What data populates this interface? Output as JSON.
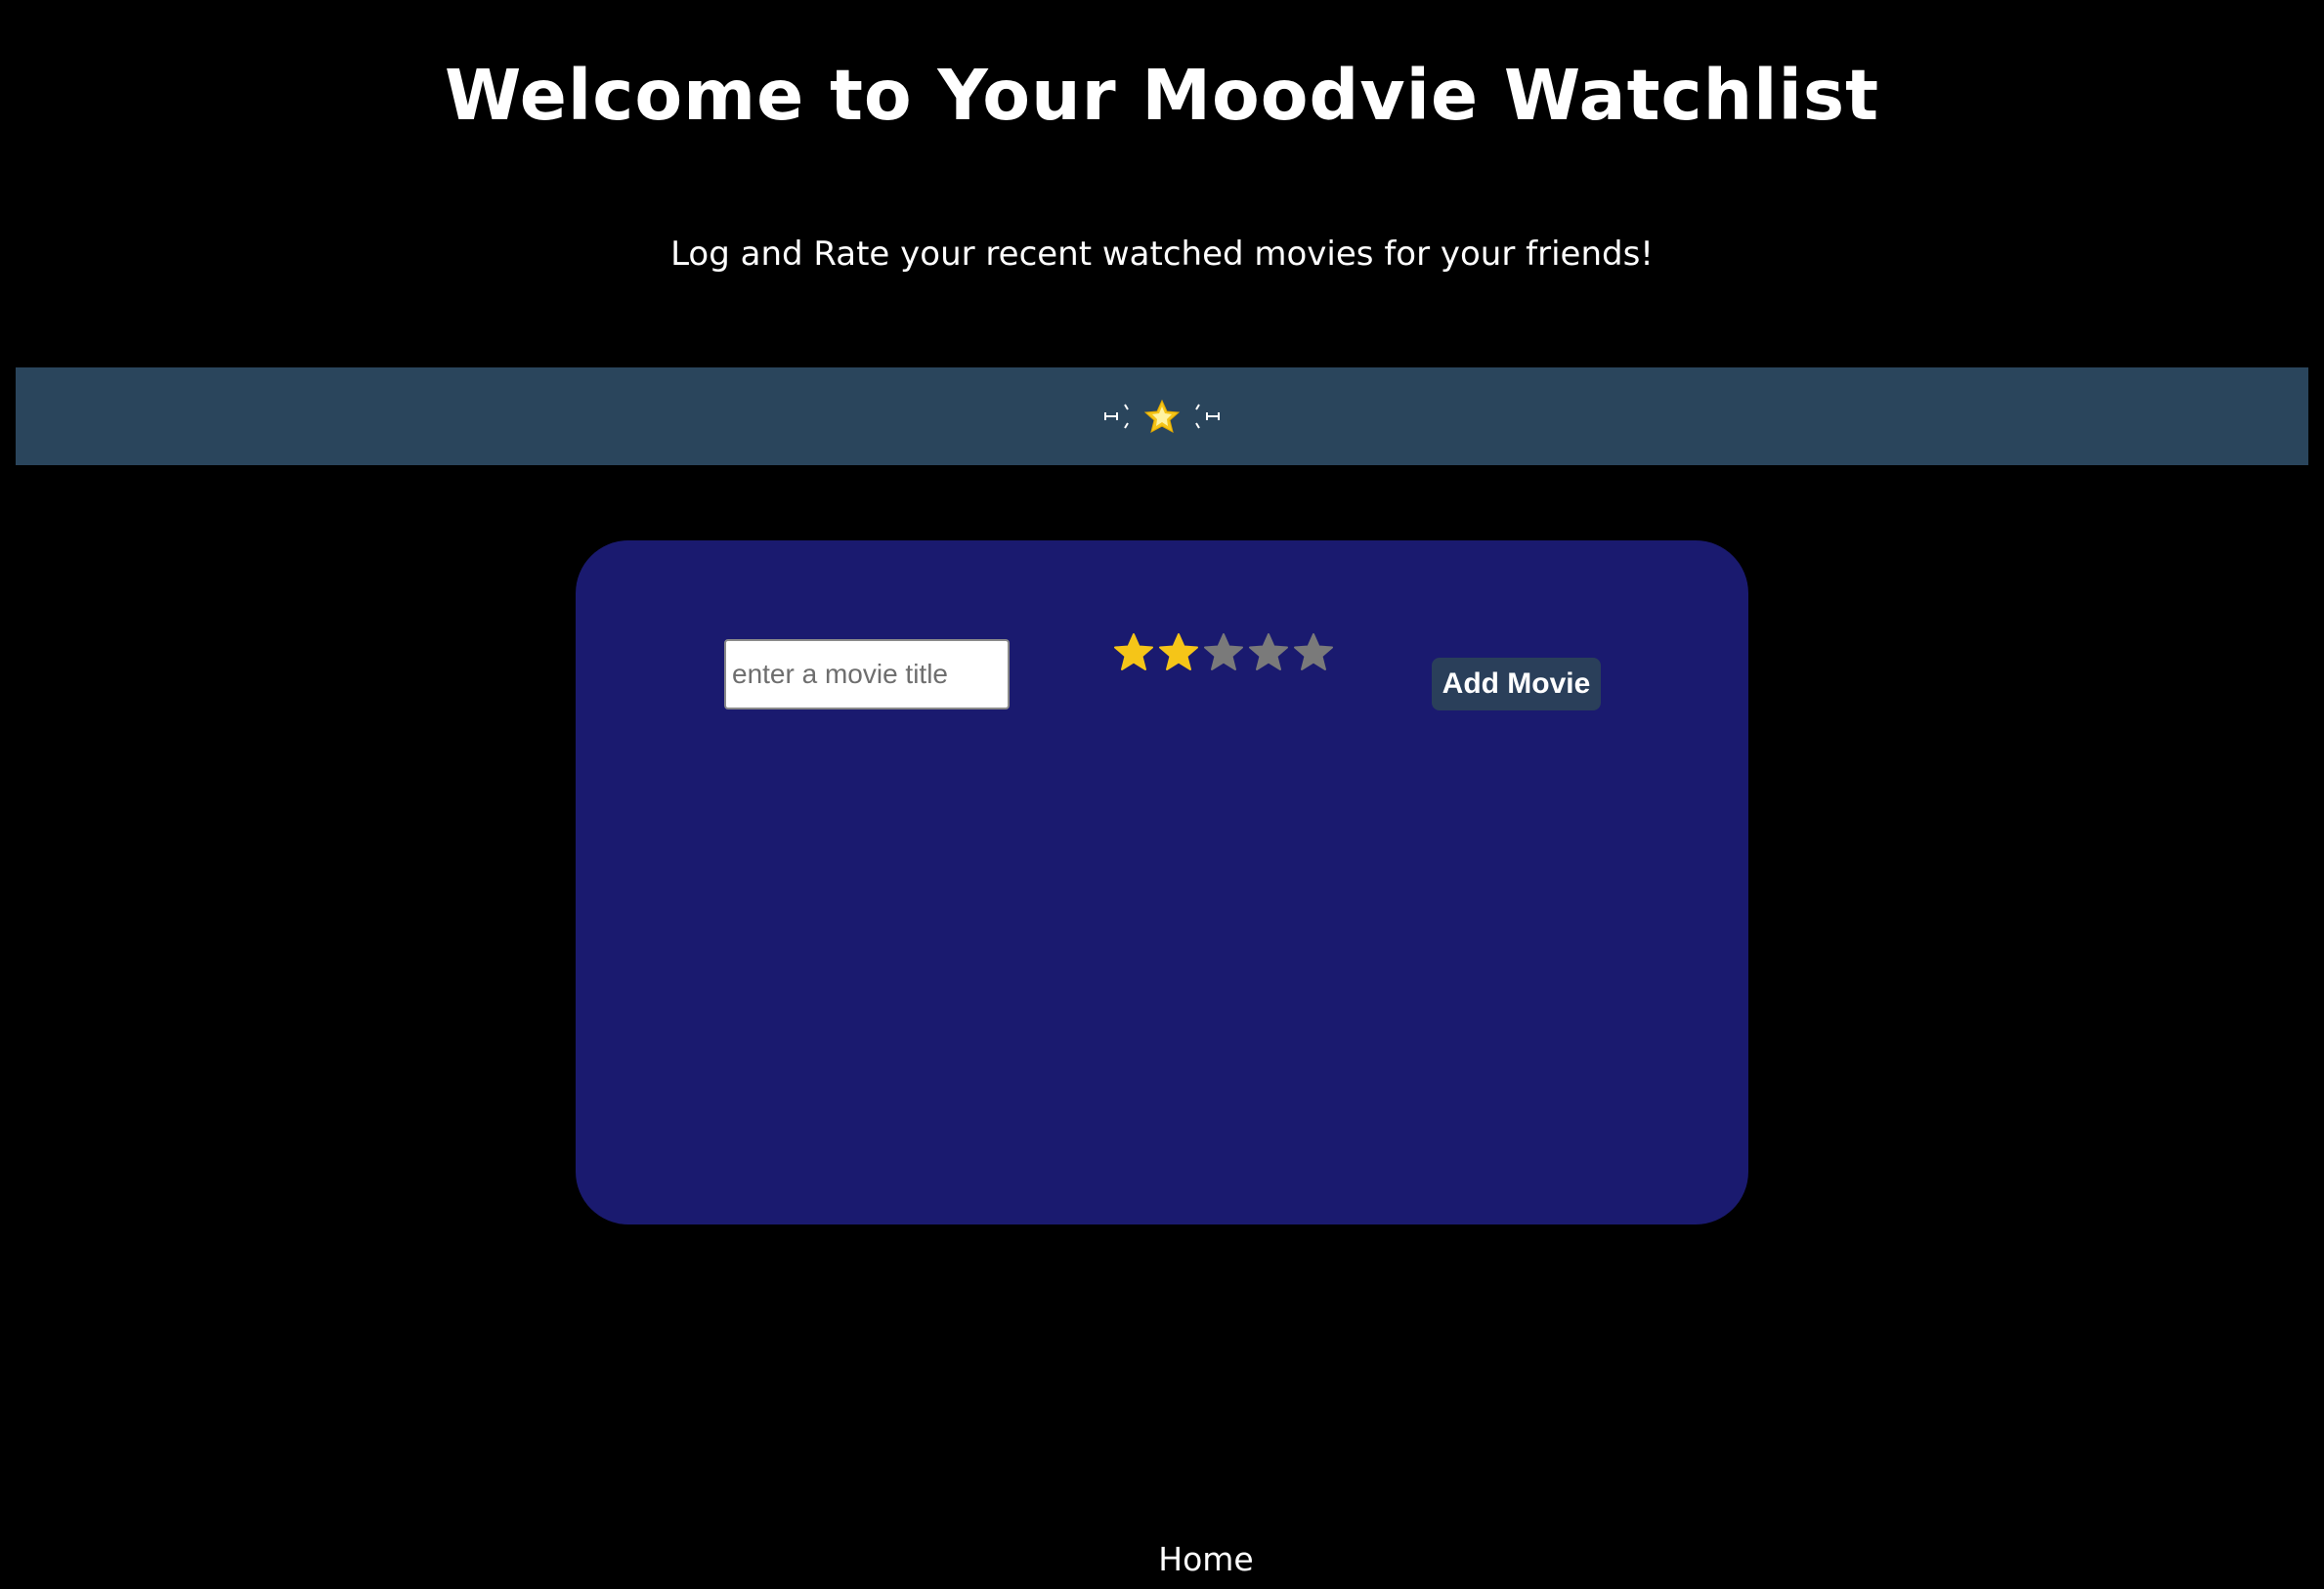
{
  "header": {
    "title": "Welcome to Your Moodvie Watchlist",
    "subtitle": "Log and Rate your recent watched movies for your friends!"
  },
  "banner": {
    "decoration_text": "⑅˚⋆ ⋆˚⑅",
    "icon": "glowing-star-icon"
  },
  "form": {
    "movie_input_value": "",
    "movie_input_placeholder": "enter a movie title",
    "rating": {
      "value": 2,
      "max": 5
    },
    "add_button_label": "Add Movie"
  },
  "footer": {
    "home_link": "Home"
  },
  "colors": {
    "background": "#000000",
    "banner": "#2a455c",
    "card": "#1a1a6f",
    "button": "#2a3f5a",
    "star_filled": "#f5c518",
    "star_empty": "#7a7a7a"
  }
}
